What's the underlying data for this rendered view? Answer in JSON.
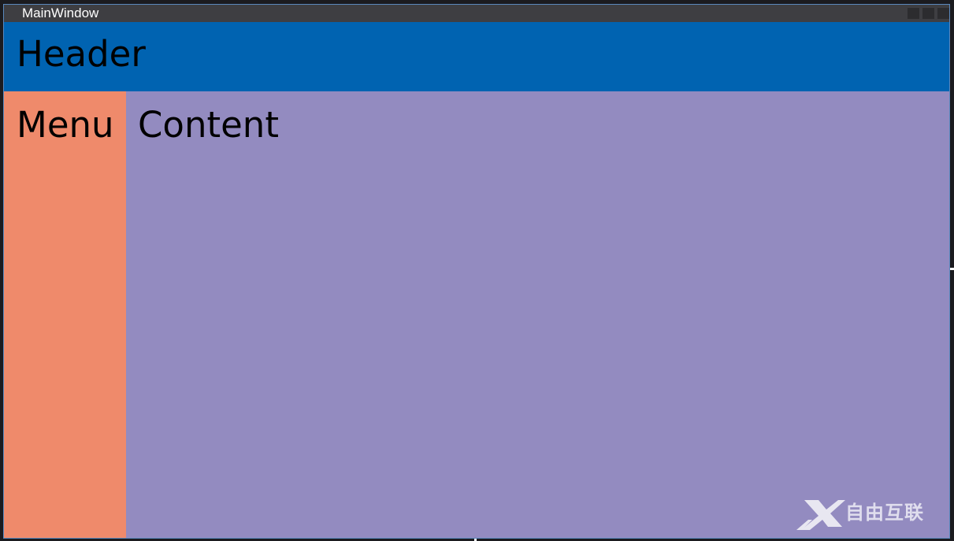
{
  "window": {
    "title": "MainWindow"
  },
  "header": {
    "label": "Header"
  },
  "menu": {
    "label": "Menu"
  },
  "content": {
    "label": "Content"
  },
  "watermark": {
    "text": "自由互联"
  },
  "colors": {
    "titlebar": "#3e3e42",
    "header": "#0063b1",
    "menu": "#ef8a6b",
    "content": "#938bc0"
  }
}
